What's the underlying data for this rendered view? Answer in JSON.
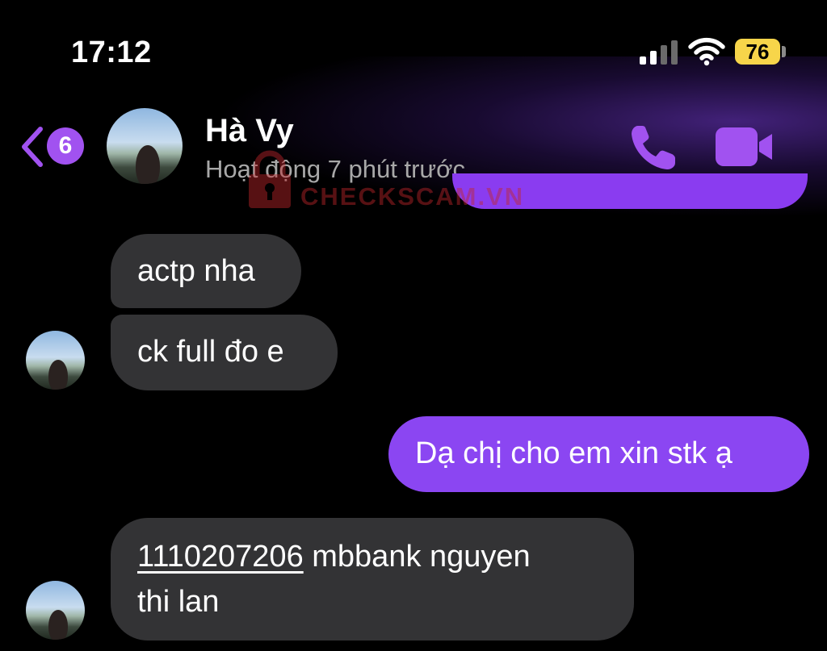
{
  "status_bar": {
    "time": "17:12",
    "battery": "76"
  },
  "header": {
    "back_badge_count": "6",
    "contact_name": "Hà Vy",
    "contact_status": "Hoạt động 7 phút trước",
    "call_icon": "phone-icon",
    "video_icon": "video-camera-icon",
    "accent_color": "#a152f0"
  },
  "watermark": {
    "text": "CHECKSCAM.VN"
  },
  "messages": [
    {
      "sender": "them",
      "text": "actp nha"
    },
    {
      "sender": "them",
      "text": "ck full đo e"
    },
    {
      "sender": "me",
      "text": "Dạ chị cho em xin stk ạ"
    },
    {
      "sender": "them",
      "account_number": "1110207206",
      "text_rest": " mbbank nguyen",
      "text_line2": "thi lan"
    }
  ],
  "colors": {
    "incoming_bubble": "#333335",
    "outgoing_bubble": "#8b46f2",
    "background": "#000000"
  }
}
